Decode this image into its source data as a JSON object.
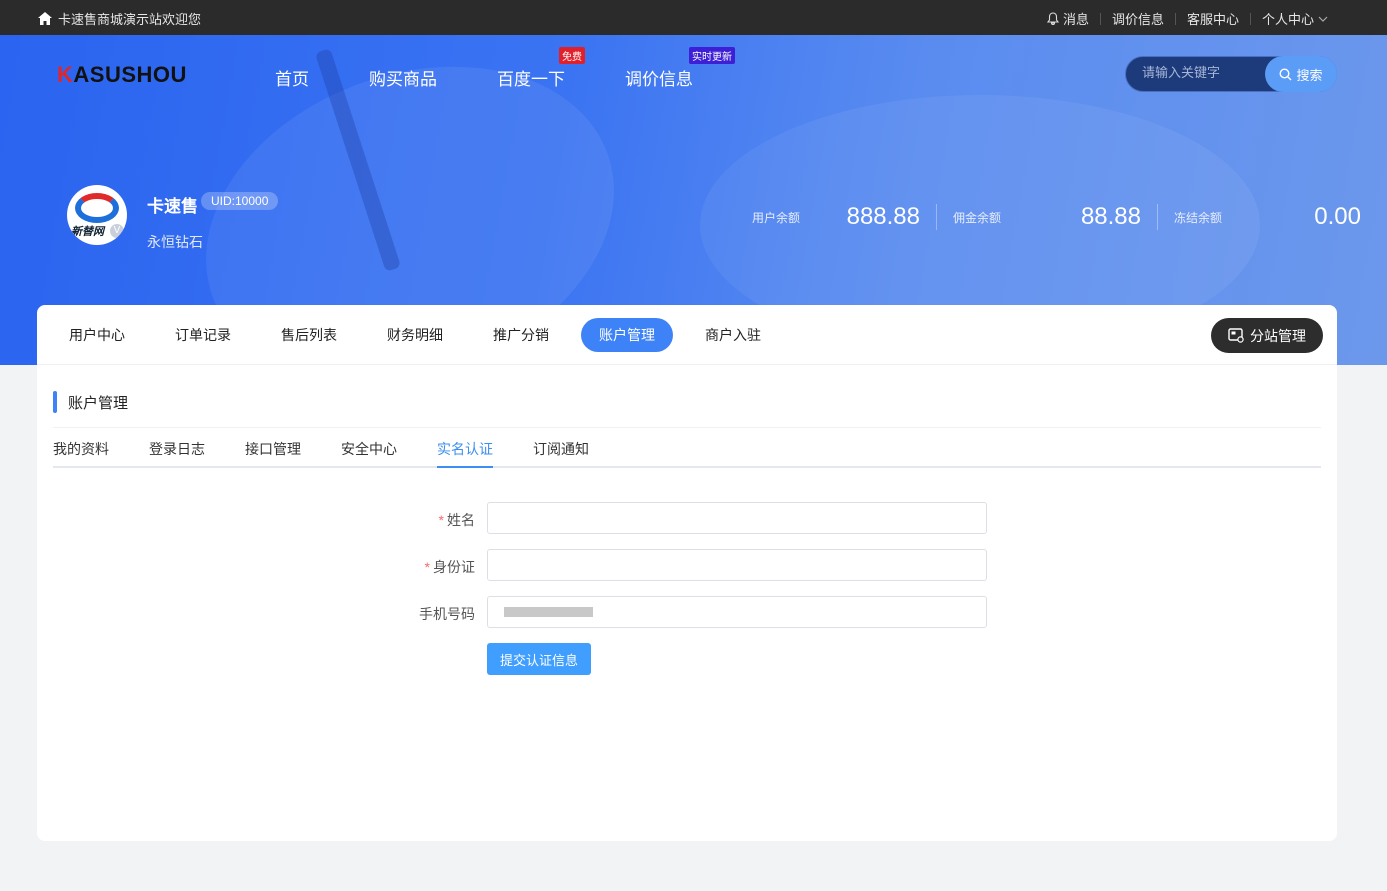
{
  "topbar": {
    "welcome": "卡速售商城演示站欢迎您",
    "links": [
      "消息",
      "调价信息",
      "客服中心",
      "个人中心"
    ]
  },
  "header": {
    "logo": "KASUSHOU",
    "nav": [
      {
        "label": "首页",
        "tag": ""
      },
      {
        "label": "购买商品",
        "tag": ""
      },
      {
        "label": "百度一下",
        "tag": "免费"
      },
      {
        "label": "调价信息",
        "tag": "实时更新"
      }
    ],
    "search": {
      "placeholder": "请输入关键字",
      "button": "搜索"
    }
  },
  "profile": {
    "avatar_text": "新替网",
    "name": "卡速售",
    "uid": "UID:10000",
    "level": "永恒钻石"
  },
  "balances": [
    {
      "label": "用户余额",
      "value": "888.88"
    },
    {
      "label": "佣金余额",
      "value": "88.88"
    },
    {
      "label": "冻结余额",
      "value": "0.00"
    }
  ],
  "tabs": [
    "用户中心",
    "订单记录",
    "售后列表",
    "财务明细",
    "推广分销",
    "账户管理",
    "商户入驻"
  ],
  "active_tab": "账户管理",
  "substation_button": "分站管理",
  "section_title": "账户管理",
  "subtabs": [
    "我的资料",
    "登录日志",
    "接口管理",
    "安全中心",
    "实名认证",
    "订阅通知"
  ],
  "active_subtab": "实名认证",
  "form": {
    "name_label": "姓名",
    "id_label": "身份证",
    "phone_label": "手机号码",
    "submit": "提交认证信息"
  },
  "colors": {
    "accent": "#3d82f6",
    "hero": "#2a64f0",
    "topbar": "#2b2b2b",
    "submit": "#409eff",
    "required": "#f56c6c"
  }
}
